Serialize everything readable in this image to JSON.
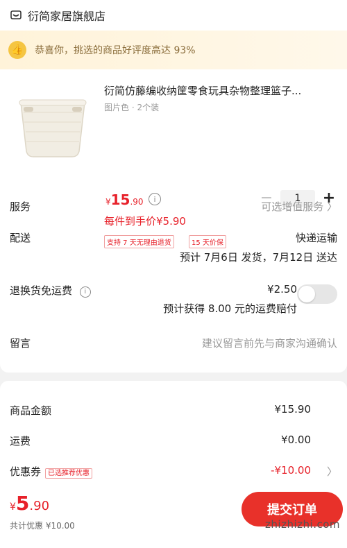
{
  "store": {
    "name": "衍简家居旗舰店",
    "icon": "store-icon"
  },
  "banner": {
    "text": "恭喜你，挑选的商品好评度高达 93%",
    "icon": "thumbs-up-icon"
  },
  "product": {
    "title": "衍简仿藤编收纳筐零食玩具杂物整理篮子...",
    "spec": "图片色 · 2个装",
    "price_symbol": "¥",
    "price_int": "15",
    "price_dec": ".90",
    "quantity": "1",
    "minus": "−",
    "plus": "+",
    "unit_price": "每件到手价¥5.90",
    "badges": [
      "支持 7 天无理由退货",
      "15 天价保"
    ]
  },
  "rows": {
    "service": {
      "label": "服务",
      "value": "可选增值服务 〉"
    },
    "shipping": {
      "label": "配送",
      "method": "快递运输",
      "eta": "预计 7月6日 发货，7月12日 送达"
    },
    "return_insurance": {
      "label": "退换货免运费",
      "price": "¥2.50",
      "note": "预计获得 8.00 元的运费赔付",
      "enabled": false
    },
    "message": {
      "label": "留言",
      "placeholder": "建议留言前先与商家沟通确认"
    }
  },
  "summary": {
    "goods_amount": {
      "label": "商品金额",
      "value": "¥15.90"
    },
    "freight": {
      "label": "运费",
      "value": "¥0.00"
    },
    "coupon": {
      "label": "优惠券",
      "badge": "已选推荐优惠",
      "value": "-¥10.00",
      "arrow": "〉"
    }
  },
  "footer": {
    "price_symbol": "¥",
    "price_int": "5",
    "price_dec": ".90",
    "discount_text": "共计优惠 ¥10.00",
    "submit_label": "提交订单",
    "watermark": "zhizhizhi.com"
  },
  "colors": {
    "accent": "#e7212a",
    "banner_bg": "#fff3d9"
  }
}
